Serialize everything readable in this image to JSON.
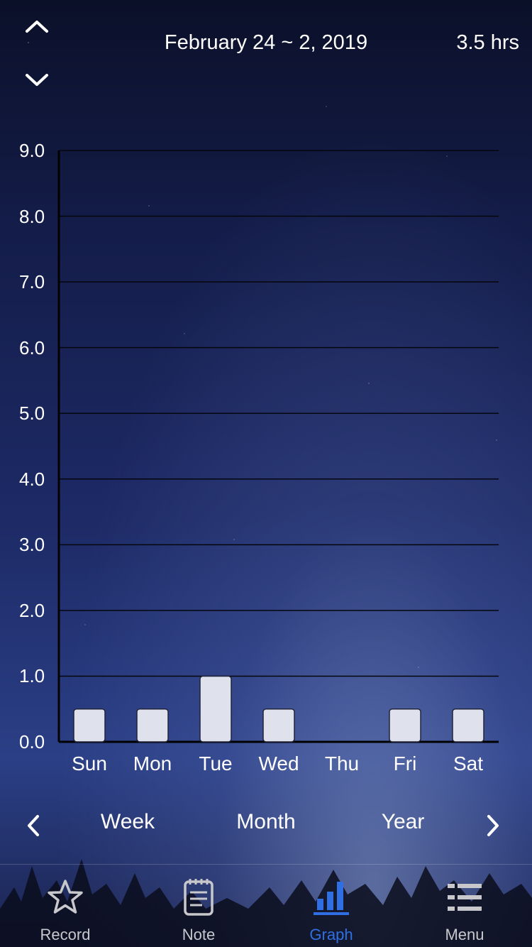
{
  "header": {
    "date_range": "February 24 ~ 2, 2019",
    "total_hours": "3.5 hrs",
    "nav_up_icon": "chevron-up-icon",
    "nav_down_icon": "chevron-down-icon"
  },
  "chart_data": {
    "type": "bar",
    "title": "",
    "xlabel": "",
    "ylabel": "",
    "categories": [
      "Sun",
      "Mon",
      "Tue",
      "Wed",
      "Thu",
      "Fri",
      "Sat"
    ],
    "values": [
      0.5,
      0.5,
      1.0,
      0.5,
      0,
      0.5,
      0.5
    ],
    "ylim": [
      0,
      9
    ],
    "yticks": [
      "0.0",
      "1.0",
      "2.0",
      "3.0",
      "4.0",
      "5.0",
      "6.0",
      "7.0",
      "8.0",
      "9.0"
    ],
    "grid": true,
    "bar_color": "#dfe2ec"
  },
  "period": {
    "prev_icon": "chevron-left-icon",
    "next_icon": "chevron-right-icon",
    "tabs": [
      "Week",
      "Month",
      "Year"
    ]
  },
  "tab_bar": {
    "items": [
      {
        "label": "Record",
        "icon": "star-icon"
      },
      {
        "label": "Note",
        "icon": "note-icon"
      },
      {
        "label": "Graph",
        "icon": "bar-chart-icon",
        "active": true
      },
      {
        "label": "Menu",
        "icon": "menu-icon"
      }
    ],
    "active_color": "#2f6fe3",
    "inactive_color": "#c8c8cc"
  }
}
